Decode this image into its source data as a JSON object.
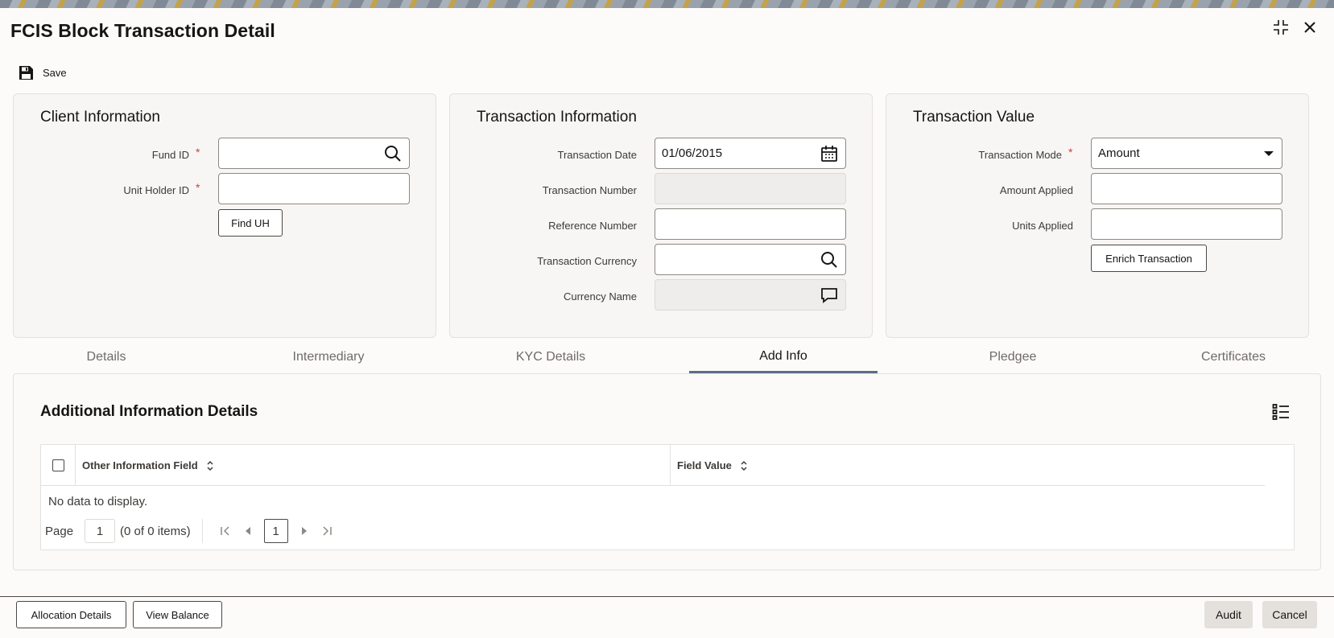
{
  "window": {
    "title": "FCIS Block Transaction Detail"
  },
  "toolbar": {
    "save_label": "Save"
  },
  "client_info": {
    "title": "Client Information",
    "fund_id_label": "Fund ID",
    "fund_id_value": "",
    "unit_holder_label": "Unit Holder ID",
    "unit_holder_value": "",
    "find_uh_label": "Find UH",
    "required_mark": "*"
  },
  "transaction_info": {
    "title": "Transaction Information",
    "date_label": "Transaction Date",
    "date_value": "01/06/2015",
    "number_label": "Transaction Number",
    "number_value": "",
    "reference_label": "Reference Number",
    "reference_value": "",
    "currency_label": "Transaction Currency",
    "currency_value": "",
    "currency_name_label": "Currency Name",
    "currency_name_value": ""
  },
  "transaction_value": {
    "title": "Transaction Value",
    "mode_label": "Transaction Mode",
    "mode_value": "Amount",
    "amount_label": "Amount Applied",
    "amount_value": "",
    "units_label": "Units Applied",
    "units_value": "",
    "enrich_label": "Enrich Transaction"
  },
  "tabs": [
    {
      "label": "Details",
      "active": false
    },
    {
      "label": "Intermediary",
      "active": false
    },
    {
      "label": "KYC Details",
      "active": false
    },
    {
      "label": "Add Info",
      "active": true
    },
    {
      "label": "Pledgee",
      "active": false
    },
    {
      "label": "Certificates",
      "active": false
    }
  ],
  "add_info": {
    "title": "Additional Information Details",
    "columns": [
      "Other Information Field",
      "Field Value"
    ],
    "empty_text": "No data to display.",
    "pager": {
      "page_label": "Page",
      "page_value": "1",
      "items_text": "(0 of 0 items)",
      "current_page": "1"
    }
  },
  "footer": {
    "allocation_label": "Allocation Details",
    "view_balance_label": "View Balance",
    "audit_label": "Audit",
    "cancel_label": "Cancel"
  },
  "colors": {
    "accent_tab": "#5c6e87",
    "required": "#c74634",
    "panel_bg": "#f7f6f5"
  }
}
